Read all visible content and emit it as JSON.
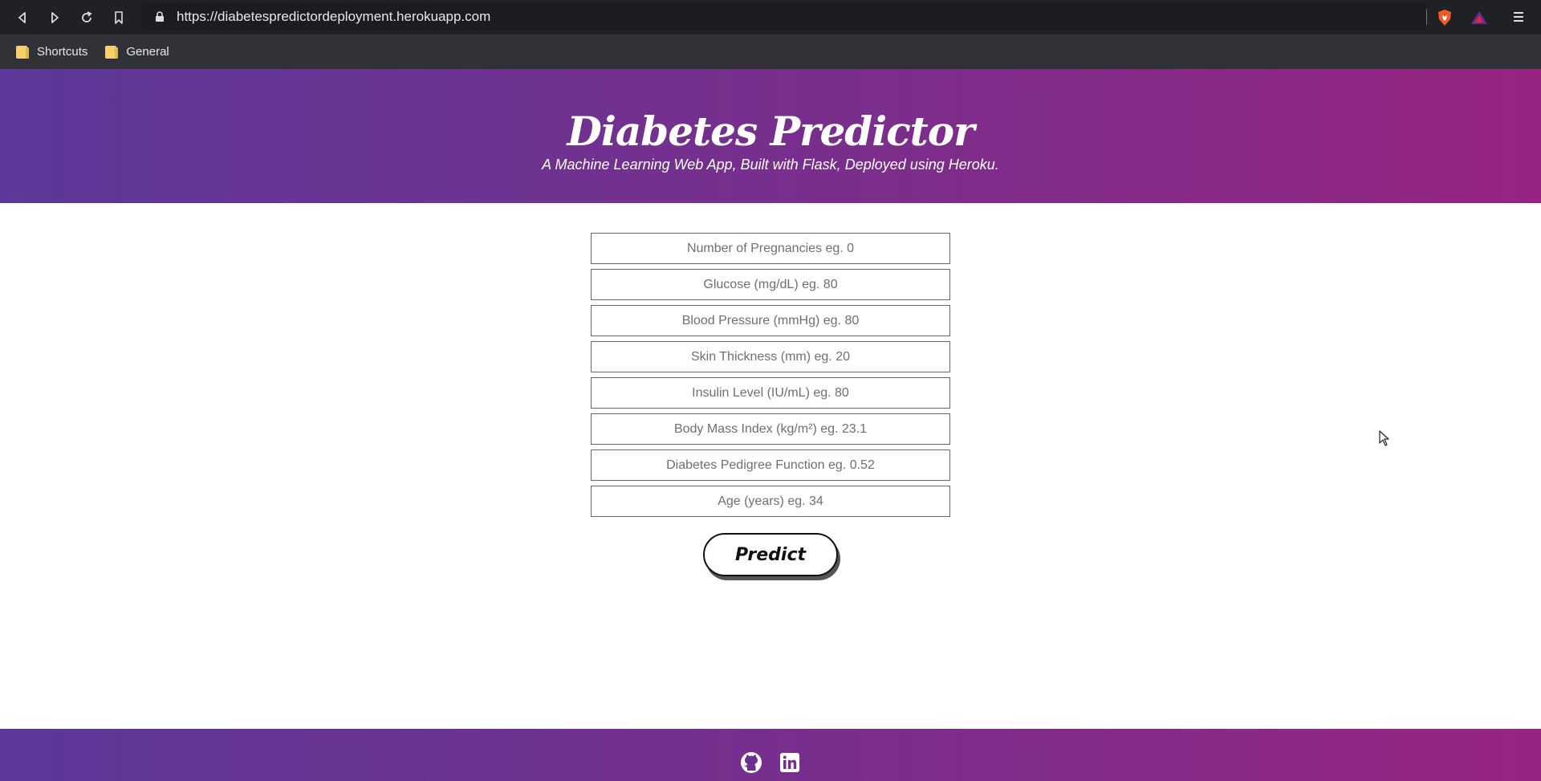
{
  "browser": {
    "url": "https://diabetespredictordeployment.herokuapp.com",
    "bookmarks": [
      {
        "label": "Shortcuts",
        "icon": "folder-icon"
      },
      {
        "label": "General",
        "icon": "folder-icon"
      }
    ]
  },
  "header": {
    "title": "Diabetes Predictor",
    "subtitle": "A Machine Learning Web App, Built with Flask, Deployed using Heroku."
  },
  "form": {
    "fields": [
      {
        "placeholder": "Number of Pregnancies eg. 0"
      },
      {
        "placeholder": "Glucose (mg/dL) eg. 80"
      },
      {
        "placeholder": "Blood Pressure (mmHg) eg. 80"
      },
      {
        "placeholder": "Skin Thickness (mm) eg. 20"
      },
      {
        "placeholder": "Insulin Level (IU/mL) eg. 80"
      },
      {
        "placeholder": "Body Mass Index (kg/m²) eg. 23.1"
      },
      {
        "placeholder": "Diabetes Pedigree Function eg. 0.52"
      },
      {
        "placeholder": "Age (years) eg. 34"
      }
    ],
    "submit_label": "Predict"
  },
  "footer": {
    "icons": [
      "github-icon",
      "linkedin-icon"
    ]
  },
  "colors": {
    "gradient_start": "#5b3899",
    "gradient_end": "#962581",
    "chrome_dark": "#202124",
    "bookmark_bar": "#303237"
  }
}
